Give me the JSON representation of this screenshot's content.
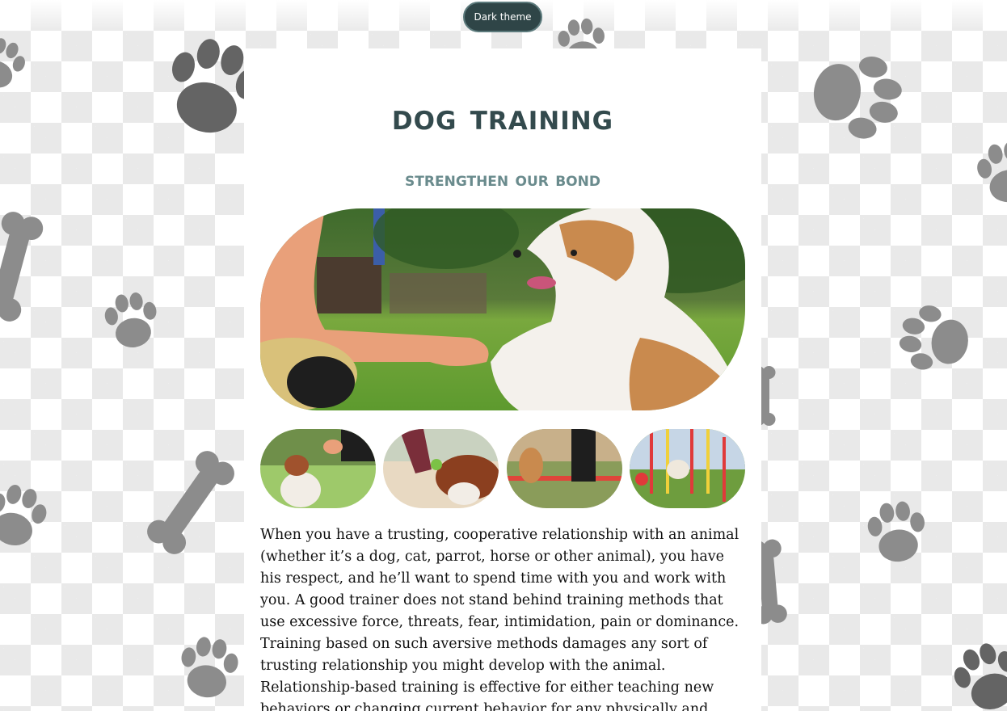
{
  "theme_toggle": {
    "label": "Dark theme"
  },
  "header": {
    "title": "Dog Training",
    "subtitle": "Strengthen our bond"
  },
  "hero_image": {
    "icon": "dog-paw-handshake-photo"
  },
  "thumbnails": [
    {
      "icon": "dog-high-five-photo"
    },
    {
      "icon": "dog-ball-photo"
    },
    {
      "icon": "dog-jump-hurdle-photo"
    },
    {
      "icon": "dog-agility-poles-photo"
    }
  ],
  "content": {
    "paragraphs": [
      "When you have a trusting, cooperative relationship with an animal (whether it’s a dog, cat, parrot, horse or other animal), you have his respect, and he’ll want to spend time with you and work with you. A good trainer does not stand behind training methods that use excessive force, threats, fear, intimidation, pain or dominance. Training based on such aversive methods damages any sort of trusting relationship you might develop with the animal.",
      "Relationship-based training is effective for either teaching new behaviors or changing current behavior for any physically and mentally healthy"
    ]
  },
  "colors": {
    "accent_dark": "#334a4d",
    "accent_light": "#6a8b8d",
    "paw_gray": "#8a8a8a",
    "button_bg": "#2f4547"
  }
}
